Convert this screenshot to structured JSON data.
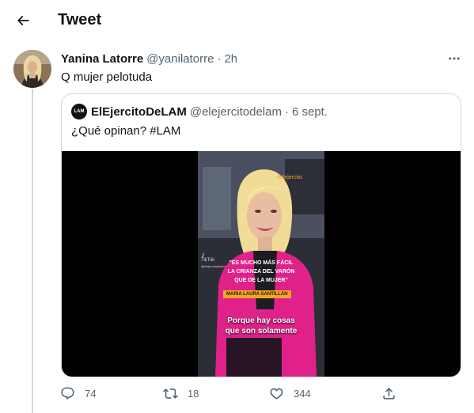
{
  "header": {
    "title": "Tweet",
    "back_icon": "arrow-left-icon"
  },
  "tweet": {
    "author_name": "Yanina Latorre",
    "author_handle": "@yanilatorre",
    "separator": "·",
    "time": "2h",
    "text": "Q mujer pelotuda",
    "more_icon": "more-horizontal-icon"
  },
  "quote": {
    "author_name": "ElEjercitoDeLAM",
    "author_handle": "@elejercitodelam",
    "separator": "·",
    "date": "6 sept.",
    "text": "¿Qué opinan? #LAM",
    "avatar_label": "LAM",
    "video": {
      "watermark": "TikTok",
      "watermark_user": "@elejercitodelam",
      "channel_tag": "#elejercito",
      "quote_line1": "\"ES MUCHO MÁS FÁCIL",
      "quote_line2": "LA CRIANZA DEL VARÓN",
      "quote_line3": "QUE DE LA MUJER\"",
      "speaker_tag": "MARIA LAURA SANTILLÁN",
      "caption_line1": "Porque hay cosas",
      "caption_line2": "que son solamente"
    }
  },
  "actions": {
    "reply_count": "74",
    "retweet_count": "18",
    "like_count": "344"
  },
  "colors": {
    "text_primary": "#0f1419",
    "text_secondary": "#536471",
    "border": "#cfd9de",
    "video_pink": "#e0218a",
    "video_tag_orange": "#f5a623"
  }
}
